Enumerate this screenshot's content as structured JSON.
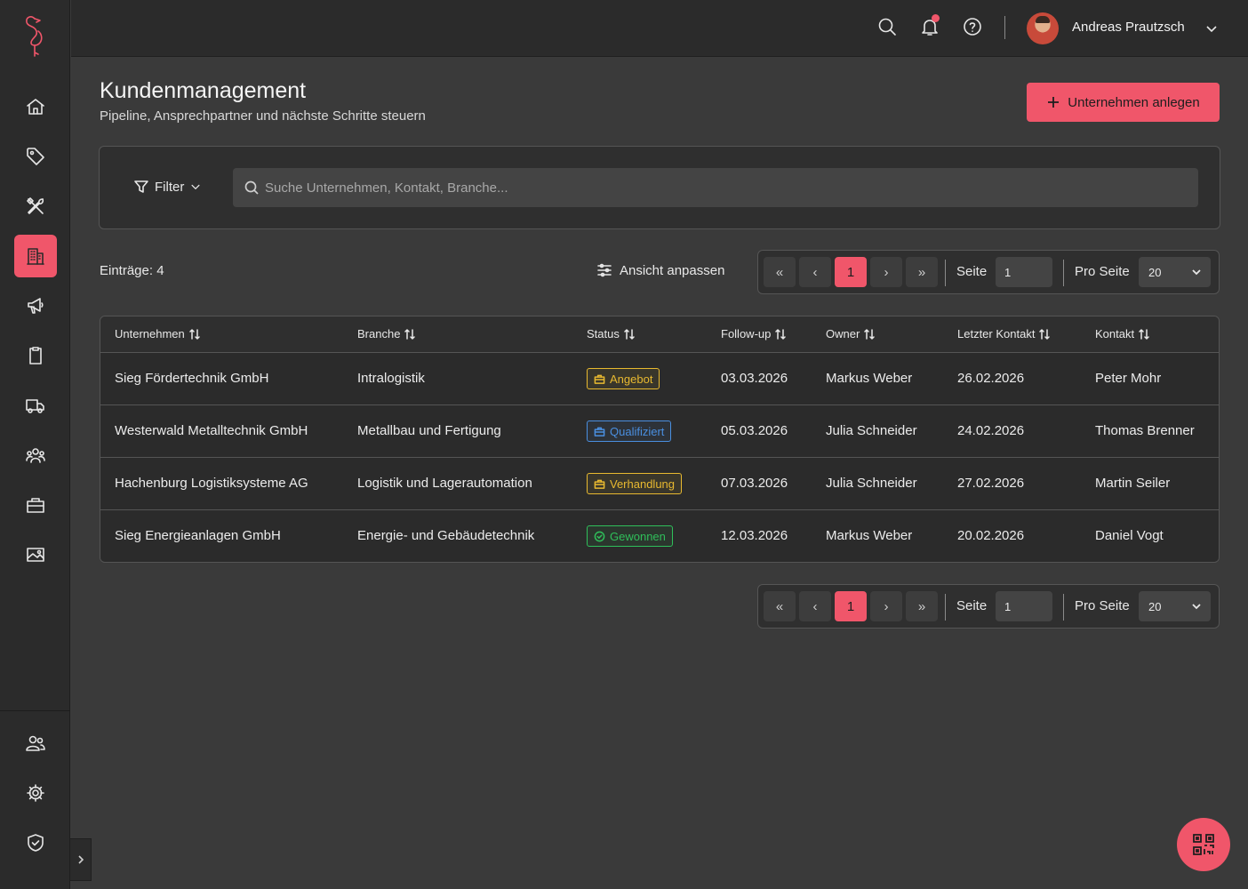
{
  "header": {
    "user_name": "Andreas Prautzsch",
    "icons": [
      "search-icon",
      "bell-icon",
      "help-icon"
    ]
  },
  "sidebar": {
    "items": [
      {
        "name": "home",
        "icon": "home-icon"
      },
      {
        "name": "tags",
        "icon": "tag-icon"
      },
      {
        "name": "tools",
        "icon": "tools-icon"
      },
      {
        "name": "companies",
        "icon": "building-icon",
        "active": true
      },
      {
        "name": "marketing",
        "icon": "megaphone-icon"
      },
      {
        "name": "tasks",
        "icon": "clipboard-icon"
      },
      {
        "name": "delivery",
        "icon": "truck-icon"
      },
      {
        "name": "teams",
        "icon": "team-icon"
      },
      {
        "name": "jobs",
        "icon": "briefcase-icon"
      },
      {
        "name": "media",
        "icon": "image-icon"
      }
    ],
    "bottom_items": [
      {
        "name": "users",
        "icon": "users-icon"
      },
      {
        "name": "settings",
        "icon": "gear-icon"
      },
      {
        "name": "security",
        "icon": "shield-icon"
      }
    ]
  },
  "page": {
    "title": "Kundenmanagement",
    "subtitle": "Pipeline, Ansprechpartner und nächste Schritte steuern",
    "create_button": "Unternehmen anlegen"
  },
  "filter": {
    "label": "Filter",
    "search_placeholder": "Suche Unternehmen, Kontakt, Branche..."
  },
  "list": {
    "entries_label": "Einträge: 4",
    "view_button": "Ansicht anpassen"
  },
  "pagination": {
    "first": "«",
    "prev": "‹",
    "current": "1",
    "next": "›",
    "last": "»",
    "page_label": "Seite",
    "page_value": "1",
    "per_page_label": "Pro Seite",
    "per_page_value": "20"
  },
  "table": {
    "columns": [
      "Unternehmen",
      "Branche",
      "Status",
      "Follow-up",
      "Owner",
      "Letzter Kontakt",
      "Kontakt"
    ],
    "rows": [
      {
        "company": "Sieg Fördertechnik GmbH",
        "industry": "Intralogistik",
        "status": "Angebot",
        "status_color": "#e8b930",
        "followup": "03.03.2026",
        "owner": "Markus Weber",
        "last_contact": "26.02.2026",
        "contact": "Peter Mohr"
      },
      {
        "company": "Westerwald Metalltechnik GmbH",
        "industry": "Metallbau und Fertigung",
        "status": "Qualifiziert",
        "status_color": "#4a8fe0",
        "followup": "05.03.2026",
        "owner": "Julia Schneider",
        "last_contact": "24.02.2026",
        "contact": "Thomas Brenner"
      },
      {
        "company": "Hachenburg Logistiksysteme AG",
        "industry": "Logistik und Lagerautomation",
        "status": "Verhandlung",
        "status_color": "#e8b930",
        "followup": "07.03.2026",
        "owner": "Julia Schneider",
        "last_contact": "27.02.2026",
        "contact": "Martin Seiler"
      },
      {
        "company": "Sieg Energieanlagen GmbH",
        "industry": "Energie- und Gebäudetechnik",
        "status": "Gewonnen",
        "status_color": "#2fbf5a",
        "followup": "12.03.2026",
        "owner": "Markus Weber",
        "last_contact": "20.02.2026",
        "contact": "Daniel Vogt"
      }
    ]
  },
  "colors": {
    "accent": "#f0566a",
    "background": "#3a3a3a",
    "panel": "#2b2b2b"
  }
}
